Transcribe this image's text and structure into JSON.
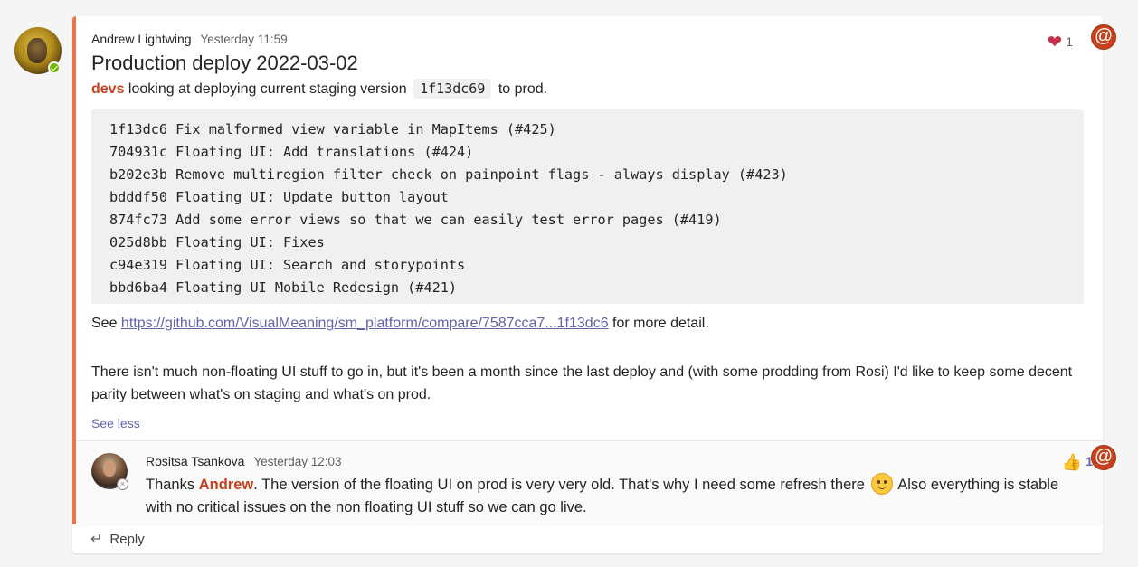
{
  "post": {
    "author": "Andrew Lightwing",
    "time": "Yesterday 11:59",
    "subject": "Production deploy 2022-03-02",
    "mention": "devs",
    "line1_a": "looking at deploying current staging version",
    "version_code": "1f13dc69",
    "line1_b": "to prod.",
    "commits": [
      "1f13dc6 Fix malformed view variable in MapItems (#425)",
      "704931c Floating UI: Add translations (#424)",
      "b202e3b Remove multiregion filter check on painpoint flags - always display (#423)",
      "bdddf50 Floating UI: Update button layout",
      "874fc73 Add some error views so that we can easily test error pages (#419)",
      "025d8bb Floating UI: Fixes",
      "c94e319 Floating UI: Search and storypoints",
      "bbd6ba4 Floating UI Mobile Redesign (#421)"
    ],
    "see_prefix": "See",
    "link_text": "https://github.com/VisualMeaning/sm_platform/compare/7587cca7...1f13dc6",
    "see_suffix": "for more detail.",
    "paragraph": "There isn't much non-floating UI stuff to go in, but it's been a month since the last deploy and (with some prodding from Rosi) I'd like to keep some decent parity between what's on staging and what's on prod.",
    "see_less": "See less",
    "reaction_count": "1",
    "reaction_icon": "heart-icon"
  },
  "reply": {
    "author": "Rositsa Tsankova",
    "time": "Yesterday 12:03",
    "text_a": "Thanks",
    "mention": "Andrew",
    "text_b": ". The version of the floating UI on prod is very very old. That's why I need some refresh there",
    "text_c": "Also everything is stable with no critical issues on the non floating UI stuff so we can go live.",
    "reaction_count": "1",
    "reaction_icon": "thumbs-up-icon"
  },
  "reply_button": {
    "label": "Reply"
  },
  "badge_symbol": "@",
  "colors": {
    "accent": "#e97548",
    "mention": "#c4314b",
    "link": "#6264a7",
    "badge": "#c4421d"
  }
}
